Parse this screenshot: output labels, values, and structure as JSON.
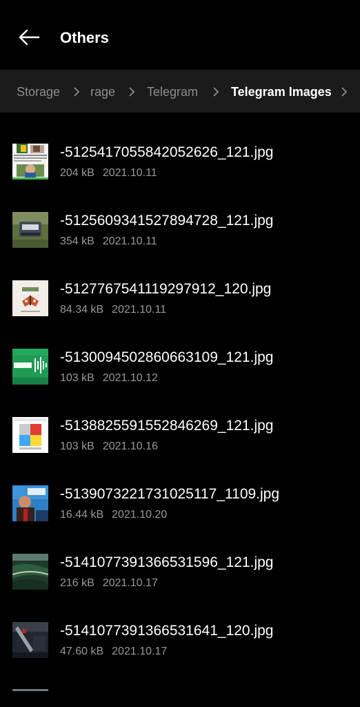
{
  "header": {
    "title": "Others"
  },
  "breadcrumb": {
    "items": [
      {
        "label": "Storage"
      },
      {
        "label": "rage"
      },
      {
        "label": "Telegram"
      },
      {
        "label": "Telegram Images"
      }
    ]
  },
  "files": [
    {
      "name": "-5125417055842052626_121.jpg",
      "size": "204 kB",
      "date": "2021.10.11",
      "thumb": "news-collage"
    },
    {
      "name": "-5125609341527894728_121.jpg",
      "size": "354 kB",
      "date": "2021.10.11",
      "thumb": "typewriter-photo"
    },
    {
      "name": "-5127767541119297912_120.jpg",
      "size": "84.34 kB",
      "date": "2021.10.11",
      "thumb": "butterfly-drawing"
    },
    {
      "name": "-5130094502860663109_121.jpg",
      "size": "103 kB",
      "date": "2021.10.12",
      "thumb": "music-banner"
    },
    {
      "name": "-5138825591552846269_121.jpg",
      "size": "103 kB",
      "date": "2021.10.16",
      "thumb": "color-grid"
    },
    {
      "name": "-5139073221731025117_1109.jpg",
      "size": "16.44 kB",
      "date": "2021.10.20",
      "thumb": "person-portrait"
    },
    {
      "name": "-5141077391366531596_121.jpg",
      "size": "216 kB",
      "date": "2021.10.17",
      "thumb": "aerial-landscape"
    },
    {
      "name": "-5141077391366531641_120.jpg",
      "size": "47.60 kB",
      "date": "2021.10.17",
      "thumb": "dark-photo"
    }
  ]
}
